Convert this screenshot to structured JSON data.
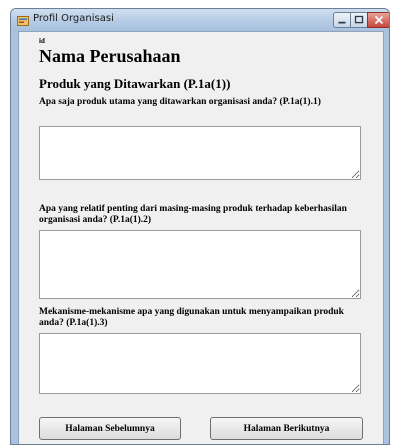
{
  "window": {
    "title": "Profil Organisasi",
    "icon": "form-app-icon",
    "controls": {
      "minimize": "minimize-icon",
      "maximize": "maximize-icon",
      "close": "close-icon"
    }
  },
  "form": {
    "id_label": "id",
    "company_name": "Nama Perusahaan",
    "section_title": "Produk yang Ditawarkan (P.1a(1))",
    "questions": [
      {
        "text": "Apa saja produk utama yang ditawarkan organisasi anda? (P.1a(1).1)",
        "value": ""
      },
      {
        "text": "Apa yang relatif penting dari masing-masing produk terhadap keberhasilan organisasi anda? (P.1a(1).2)",
        "value": ""
      },
      {
        "text": "Mekanisme-mekanisme apa yang digunakan untuk menyampaikan produk anda? (P.1a(1).3)",
        "value": ""
      }
    ]
  },
  "buttons": {
    "prev_label": "Halaman Sebelumnya",
    "next_label": "Halaman Berikutnya"
  }
}
